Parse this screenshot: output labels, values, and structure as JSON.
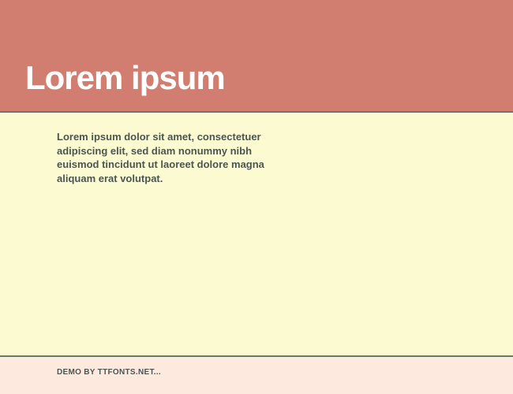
{
  "header": {
    "title": "Lorem ipsum"
  },
  "main": {
    "body_text": "Lorem ipsum dolor sit amet, consectetuer adipiscing elit, sed diam nonummy nibh euismod tincidunt ut laoreet dolore magna aliquam erat volutpat."
  },
  "footer": {
    "text": "DEMO BY TTFONTS.NET..."
  }
}
